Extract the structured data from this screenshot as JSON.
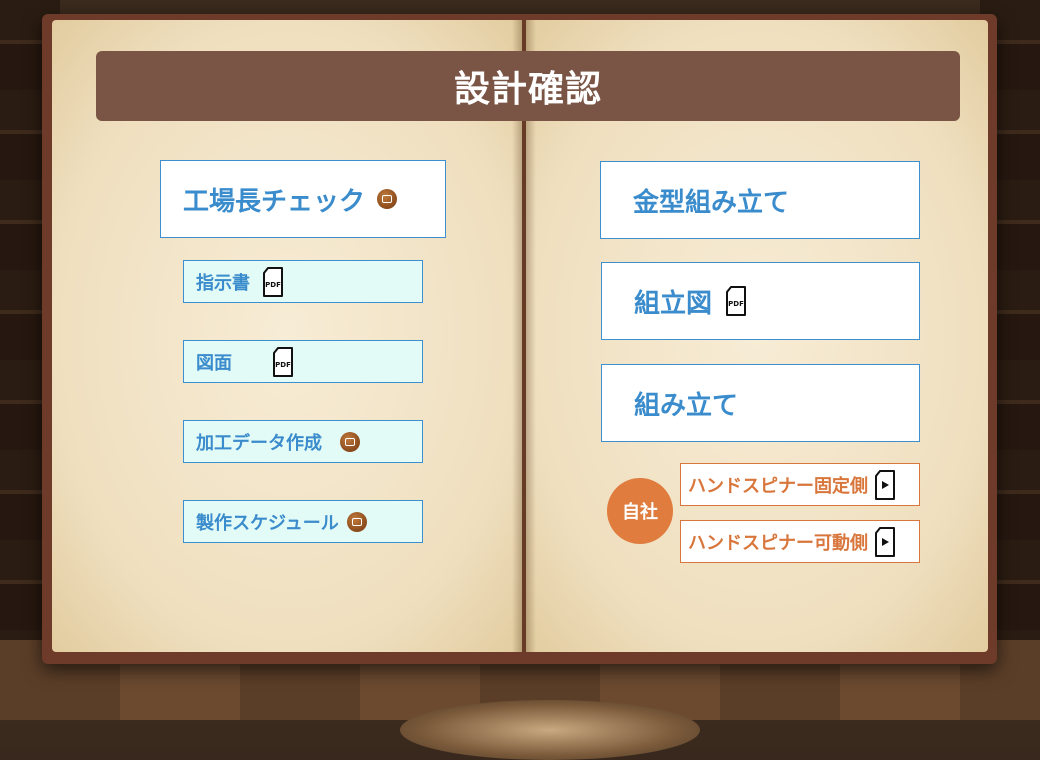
{
  "title": "設計確認",
  "left": {
    "factory_check": "工場長チェック",
    "instructions": "指示書",
    "drawing": "図面",
    "processing_data": "加工データ作成",
    "schedule": "製作スケジュール"
  },
  "right": {
    "mold_assembly": "金型組み立て",
    "assembly_drawing": "組立図",
    "assembly": "組み立て",
    "company_badge": "自社",
    "spinner_fixed": "ハンドスピナー固定側",
    "spinner_moving": "ハンドスピナー可動側"
  },
  "icons": {
    "pdf_label": "PDF"
  },
  "colors": {
    "title_bg": "#7a5546",
    "blue_text": "#3a8ccc",
    "orange_accent": "#df7c3e",
    "small_button_bg": "#e3fbf7"
  }
}
